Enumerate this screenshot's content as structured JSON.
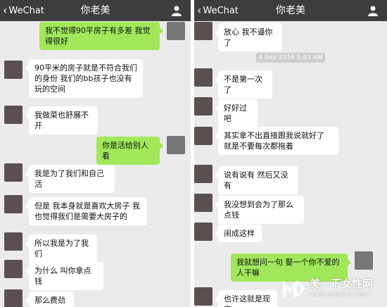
{
  "left_panel": {
    "nav": {
      "back_label": "WeChat",
      "title": "你老美"
    },
    "messages": [
      {
        "side": "out",
        "text": "我不觉得90平房子有多差 我觉得很好"
      },
      {
        "side": "in",
        "text": "90平米的房子就是不符合我们的身份 我们的bb孩子也没有玩的空间"
      },
      {
        "side": "in",
        "text": "我做菜也舒展不开"
      },
      {
        "side": "out",
        "text": "你是活给别人看"
      },
      {
        "side": "in",
        "text": "我是为了我们和自己活"
      },
      {
        "side": "in",
        "text": "但是 我本身就是喜欢大房子 我也觉得我们是需要大房子的"
      },
      {
        "side": "in",
        "text": "所以我是为了我们"
      },
      {
        "side": "in",
        "text": "为什么 叫你拿点钱"
      },
      {
        "side": "in",
        "text": "那么费劲"
      }
    ]
  },
  "right_panel": {
    "nav": {
      "back_label": "WeChat",
      "title": "你老美"
    },
    "timestamp": "4 Sep 2016 1:43 AM",
    "messages": [
      {
        "side": "in",
        "text": "放心 我不逼你了"
      },
      {
        "side": "in",
        "text": "不是第一次了"
      },
      {
        "side": "in",
        "text": "好好过吧"
      },
      {
        "side": "in",
        "text": "其实拿不出直接跟我说就好了 就是不要每次都拖着"
      },
      {
        "side": "in",
        "text": "说有说有 然后又没有"
      },
      {
        "side": "in",
        "text": "我没想到会为了那么点钱"
      },
      {
        "side": "in",
        "text": "闹成这样"
      },
      {
        "side": "out",
        "text": "我就想问一句 娶一个你不爱的人干嘛"
      },
      {
        "side": "in",
        "text": "也许这就是现实"
      }
    ]
  },
  "watermark": {
    "name": "美一下女性网",
    "url": "www.meiyixia.com"
  },
  "colors": {
    "nav_bg": "#3d3d3d",
    "chat_bg": "#ebebeb",
    "bubble_out": "#a0e75a",
    "bubble_in": "#ffffff"
  }
}
